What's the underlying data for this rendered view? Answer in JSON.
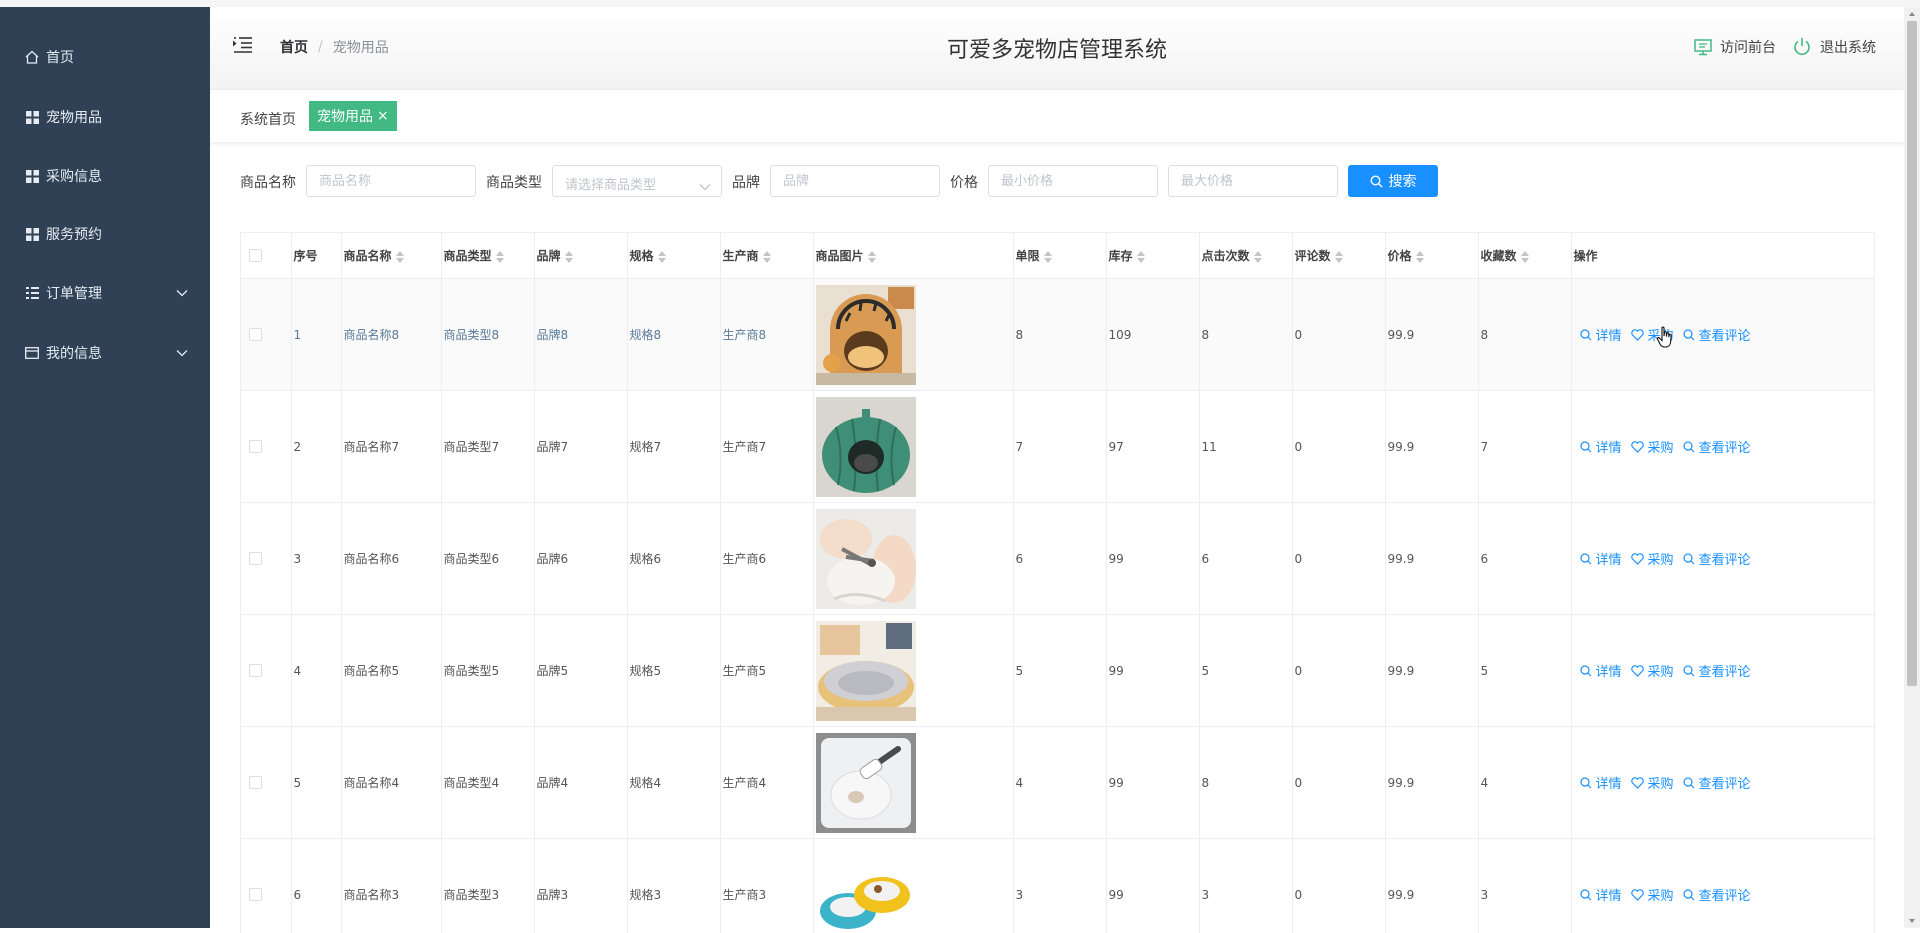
{
  "app": {
    "title": "可爱多宠物店管理系统"
  },
  "colors": {
    "sidebar_bg": "#304156",
    "accent": "#1890ff",
    "tag_active": "#42b983"
  },
  "sidebar": {
    "items": [
      {
        "label": "首页",
        "icon": "home-icon"
      },
      {
        "label": "宠物用品",
        "icon": "grid-icon"
      },
      {
        "label": "采购信息",
        "icon": "grid-icon"
      },
      {
        "label": "服务预约",
        "icon": "grid-icon"
      },
      {
        "label": "订单管理",
        "icon": "list-icon",
        "expandable": true
      },
      {
        "label": "我的信息",
        "icon": "card-icon",
        "expandable": true
      }
    ]
  },
  "header": {
    "breadcrumb": {
      "home": "首页",
      "separator": "/",
      "current": "宠物用品"
    },
    "visit_front": "访问前台",
    "logout": "退出系统"
  },
  "tags": {
    "home": "系统首页",
    "active": "宠物用品",
    "close": "×"
  },
  "search": {
    "name_label": "商品名称",
    "name_placeholder": "商品名称",
    "type_label": "商品类型",
    "type_placeholder": "请选择商品类型",
    "brand_label": "品牌",
    "brand_placeholder": "品牌",
    "price_label": "价格",
    "min_placeholder": "最小价格",
    "max_placeholder": "最大价格",
    "button": "搜索"
  },
  "table": {
    "headers": [
      "序号",
      "商品名称",
      "商品类型",
      "品牌",
      "规格",
      "生产商",
      "商品图片",
      "单限",
      "库存",
      "点击次数",
      "评论数",
      "价格",
      "收藏数",
      "操作"
    ],
    "actions": {
      "detail": "详情",
      "buy": "采购",
      "comments": "查看评论"
    },
    "rows": [
      {
        "index": "1",
        "name": "商品名称8",
        "type": "商品类型8",
        "brand": "品牌8",
        "spec": "规格8",
        "maker": "生产商8",
        "image": "pet-house-tiger",
        "limit": "8",
        "stock": "109",
        "clicks": "8",
        "reviews": "0",
        "price": "99.9",
        "favorites": "8"
      },
      {
        "index": "2",
        "name": "商品名称7",
        "type": "商品类型7",
        "brand": "品牌7",
        "spec": "规格7",
        "maker": "生产商7",
        "image": "pet-bed-pumpkin",
        "limit": "7",
        "stock": "97",
        "clicks": "11",
        "reviews": "0",
        "price": "99.9",
        "favorites": "7"
      },
      {
        "index": "3",
        "name": "商品名称6",
        "type": "商品类型6",
        "brand": "品牌6",
        "spec": "规格6",
        "maker": "生产商6",
        "image": "nail-clipper",
        "limit": "6",
        "stock": "99",
        "clicks": "6",
        "reviews": "0",
        "price": "99.9",
        "favorites": "6"
      },
      {
        "index": "4",
        "name": "商品名称5",
        "type": "商品类型5",
        "brand": "品牌5",
        "spec": "规格5",
        "maker": "生产商5",
        "image": "plush-bed",
        "limit": "5",
        "stock": "99",
        "clicks": "5",
        "reviews": "0",
        "price": "99.9",
        "favorites": "5"
      },
      {
        "index": "5",
        "name": "商品名称4",
        "type": "商品类型4",
        "brand": "品牌4",
        "spec": "规格4",
        "maker": "生产商4",
        "image": "grooming-brush",
        "limit": "4",
        "stock": "99",
        "clicks": "8",
        "reviews": "0",
        "price": "99.9",
        "favorites": "4"
      },
      {
        "index": "6",
        "name": "商品名称3",
        "type": "商品类型3",
        "brand": "品牌3",
        "spec": "规格3",
        "maker": "生产商3",
        "image": "pet-bowls",
        "limit": "3",
        "stock": "99",
        "clicks": "3",
        "reviews": "0",
        "price": "99.9",
        "favorites": "3"
      }
    ]
  }
}
